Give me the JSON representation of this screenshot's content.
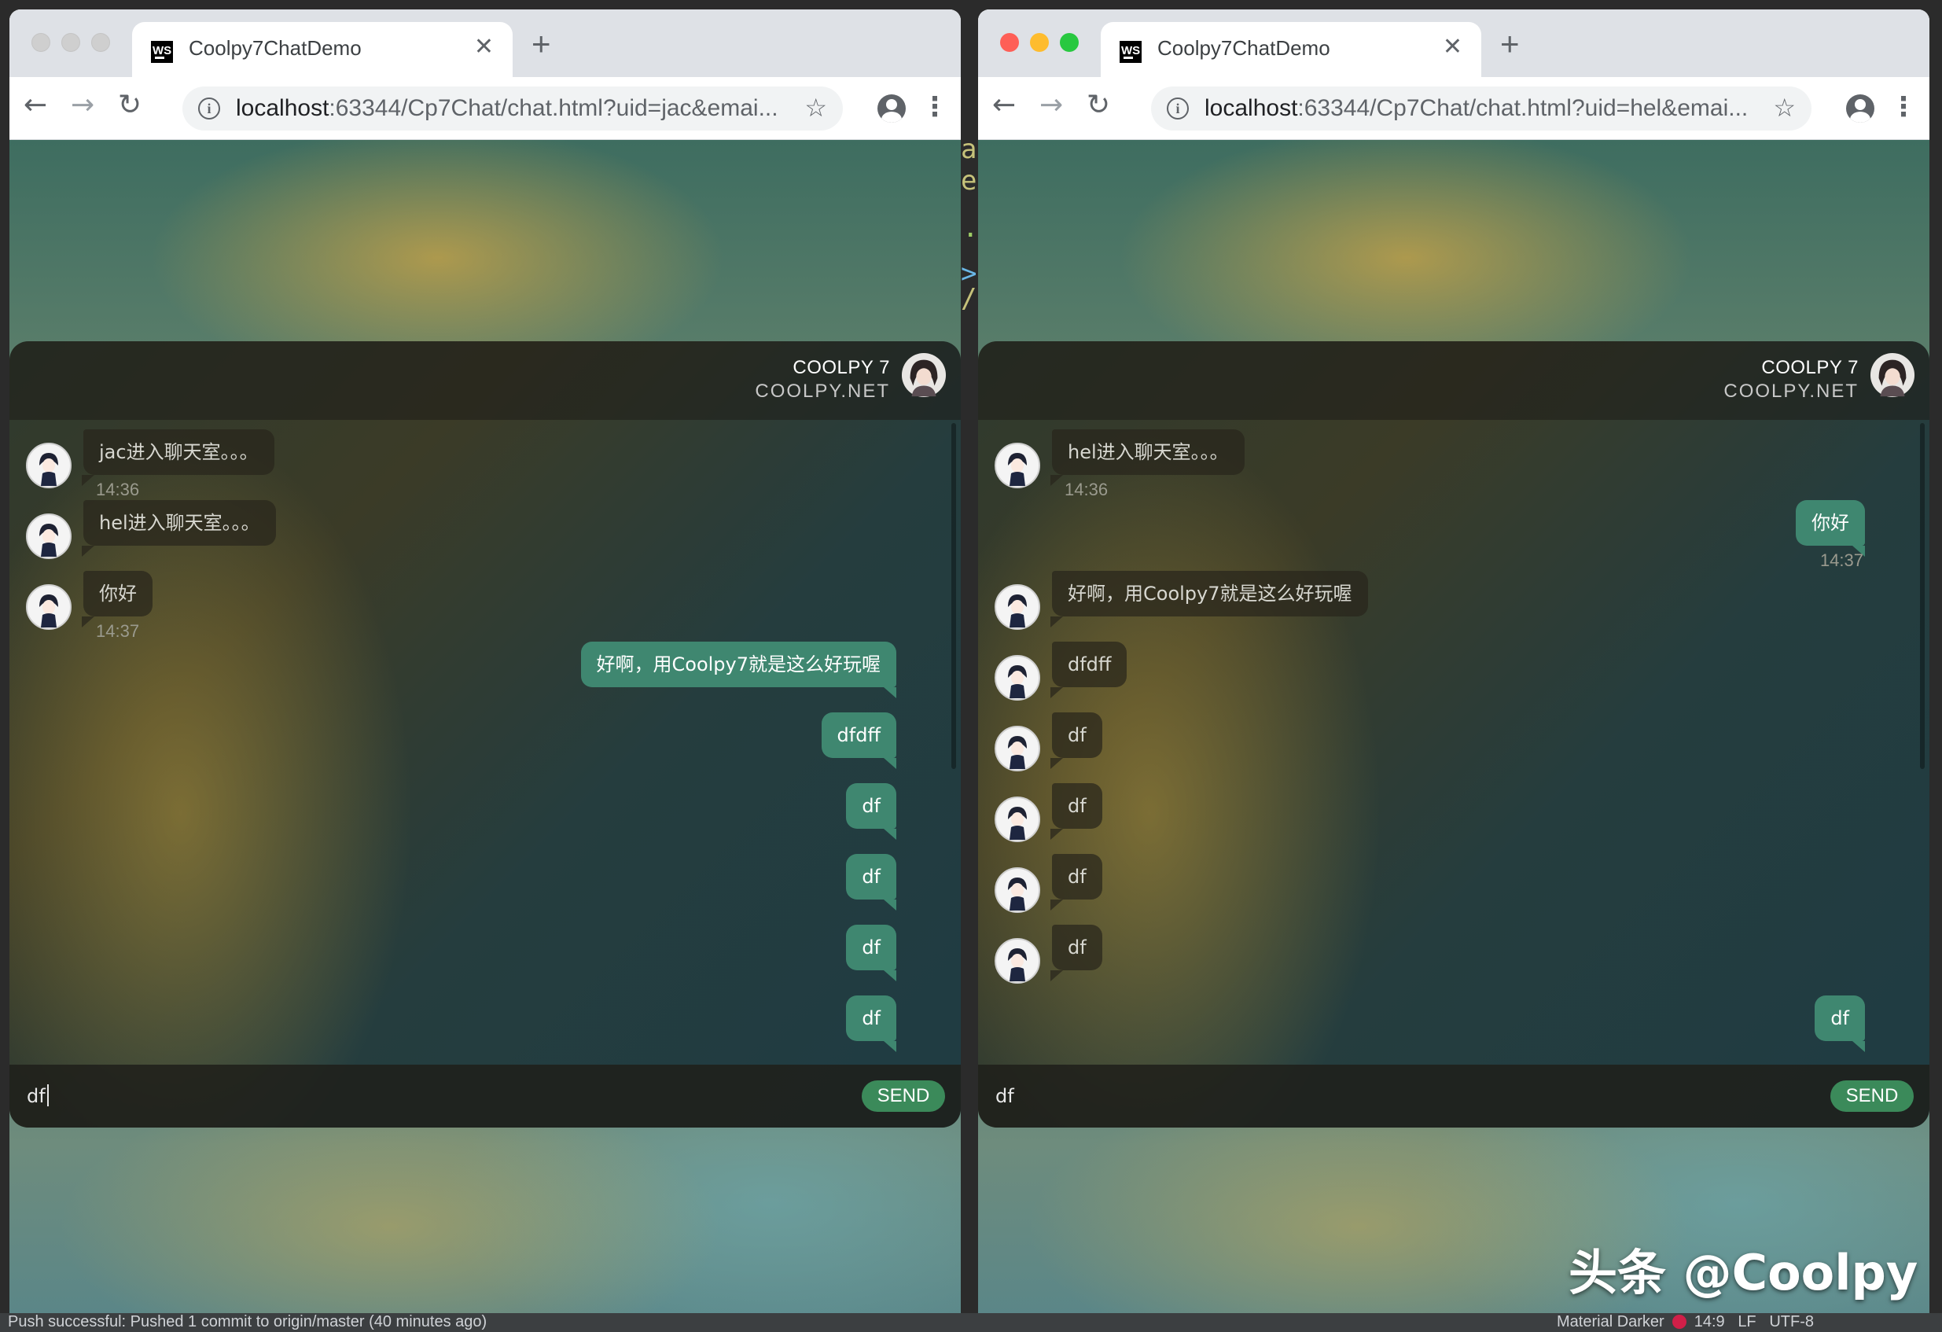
{
  "ide": {
    "status_left": "Push successful: Pushed 1 commit to origin/master (40 minutes ago)",
    "status_theme": "Material Darker",
    "status_position": "14:9",
    "status_lf": "LF",
    "status_encoding": "UTF-8"
  },
  "windows": [
    {
      "tab_title": "Coolpy7ChatDemo",
      "favicon_text": "WS",
      "url_host": "localhost",
      "url_rest": ":63344/Cp7Chat/chat.html?uid=jac&emai...",
      "chat": {
        "brand_line1": "COOLPY 7",
        "brand_line2": "COOLPY.NET",
        "messages": [
          {
            "side": "in",
            "text": "jac进入聊天室。。。",
            "time": "14:36"
          },
          {
            "side": "in",
            "text": "hel进入聊天室。。。",
            "time": ""
          },
          {
            "side": "in",
            "text": "你好",
            "time": "14:37"
          },
          {
            "side": "out",
            "text": "好啊，用Coolpy7就是这么好玩喔",
            "time": ""
          },
          {
            "side": "out",
            "text": "dfdff",
            "time": ""
          },
          {
            "side": "out",
            "text": "df",
            "time": ""
          },
          {
            "side": "out",
            "text": "df",
            "time": ""
          },
          {
            "side": "out",
            "text": "df",
            "time": ""
          },
          {
            "side": "out",
            "text": "df",
            "time": ""
          }
        ],
        "input_value": "df",
        "send_label": "SEND"
      }
    },
    {
      "tab_title": "Coolpy7ChatDemo",
      "favicon_text": "WS",
      "url_host": "localhost",
      "url_rest": ":63344/Cp7Chat/chat.html?uid=hel&emai...",
      "chat": {
        "brand_line1": "COOLPY 7",
        "brand_line2": "COOLPY.NET",
        "messages": [
          {
            "side": "in",
            "text": "hel进入聊天室。。。",
            "time": "14:36"
          },
          {
            "side": "out",
            "text": "你好",
            "time": "14:37"
          },
          {
            "side": "in",
            "text": "好啊，用Coolpy7就是这么好玩喔",
            "time": ""
          },
          {
            "side": "in",
            "text": "dfdff",
            "time": ""
          },
          {
            "side": "in",
            "text": "df",
            "time": ""
          },
          {
            "side": "in",
            "text": "df",
            "time": ""
          },
          {
            "side": "in",
            "text": "df",
            "time": ""
          },
          {
            "side": "in",
            "text": "df",
            "time": ""
          },
          {
            "side": "out",
            "text": "df",
            "time": ""
          }
        ],
        "input_value": "df",
        "send_label": "SEND"
      }
    }
  ],
  "watermark": "头条 @Coolpy",
  "colors": {
    "bubble_out": "#3f8770",
    "send_button": "#3b8a5a",
    "close_red": "#fe5f57",
    "minimize_yellow": "#febc2e",
    "zoom_green": "#28c840"
  },
  "icons": [
    "back-arrow-icon",
    "forward-arrow-icon",
    "reload-icon",
    "info-icon",
    "star-icon",
    "profile-icon",
    "menu-kebab-icon",
    "close-icon",
    "new-tab-icon",
    "avatar-icon"
  ]
}
